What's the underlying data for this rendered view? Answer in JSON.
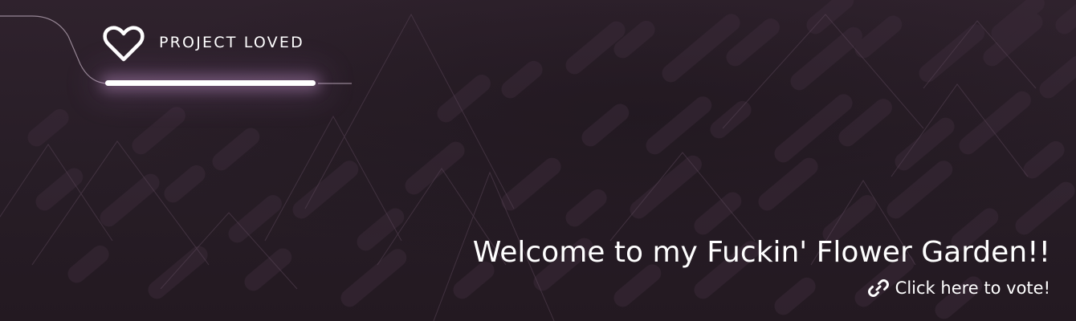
{
  "banner": {
    "logo": {
      "icon": "heart-outline-icon",
      "text": "PROJECT LOVED"
    },
    "title": "Welcome to my Fuckin' Flower Garden!!",
    "vote_link": {
      "icon": "link-icon",
      "label": "Click here to vote!"
    }
  },
  "colors": {
    "background": "#271d26",
    "pattern": "#3a2a38",
    "text": "#ffffff",
    "glow": "#d6a8e0"
  }
}
